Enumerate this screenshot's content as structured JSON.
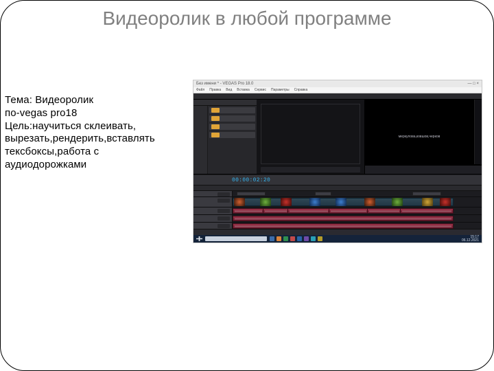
{
  "slide": {
    "title": "Видеоролик в любой программе",
    "body_lines": [
      "Тема: Видеоролик",
      "по-vegas pro18",
      "Цель:научиться склеивать,",
      "вырезать,рендерить,вставлять",
      "тексбоксы,работа с",
      "аудиодорожками"
    ]
  },
  "screenshot": {
    "app_title": "Без имени * - VEGAS Pro 18.0",
    "menu": [
      "Файл",
      "Правка",
      "Вид",
      "Вставка",
      "Сервис",
      "Параметры",
      "Справка"
    ],
    "preview_text": "меркулова,ковшов,черков",
    "timecode": "00:00:02:20",
    "taskbar_time": "15:17",
    "taskbar_date": "06.12.2021"
  }
}
